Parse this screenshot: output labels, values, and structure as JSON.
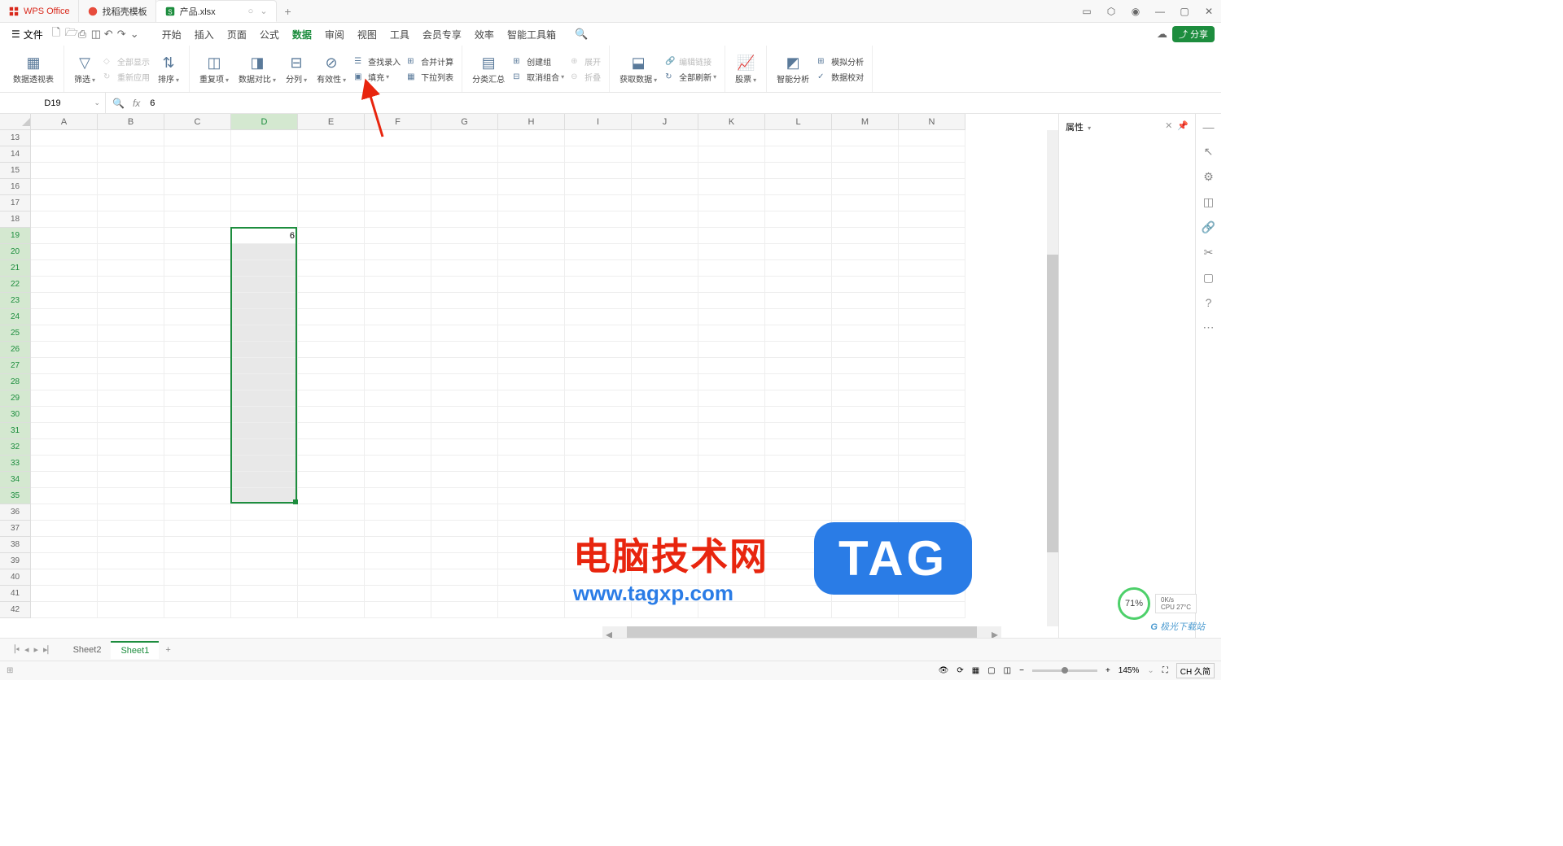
{
  "titlebar": {
    "home_tab": "WPS Office",
    "template_tab": "找稻壳模板",
    "file_tab": "产品.xlsx",
    "add": "+"
  },
  "menubar": {
    "file": "文件",
    "items": [
      "开始",
      "插入",
      "页面",
      "公式",
      "数据",
      "审阅",
      "视图",
      "工具",
      "会员专享",
      "效率",
      "智能工具箱"
    ],
    "active_index": 4,
    "share": "分享"
  },
  "ribbon": {
    "pivot": "数据透视表",
    "filter": "筛选",
    "show_all": "全部显示",
    "reapply": "重新应用",
    "sort": "排序",
    "dup": "重复项",
    "compare": "数据对比",
    "split": "分列",
    "validity": "有效性",
    "find_input": "查找录入",
    "fill": "填充",
    "consolidate": "合并计算",
    "dropdown": "下拉列表",
    "subtotal": "分类汇总",
    "group": "创建组",
    "ungroup": "取消组合",
    "expand": "展开",
    "collapse": "折叠",
    "getdata": "获取数据",
    "editlinks": "编辑链接",
    "refresh": "全部刷新",
    "stock": "股票",
    "smart": "智能分析",
    "sim": "模拟分析",
    "valid2": "数据校对"
  },
  "formulabar": {
    "cell_ref": "D19",
    "fx": "fx",
    "value": "6"
  },
  "side": {
    "properties": "属性"
  },
  "grid": {
    "cols": [
      "A",
      "B",
      "C",
      "D",
      "E",
      "F",
      "G",
      "H",
      "I",
      "J",
      "K",
      "L",
      "M",
      "N"
    ],
    "rows_start": 13,
    "rows_end": 42,
    "active_cell": "D19",
    "active_value": "6",
    "sel_col_index": 3,
    "sel_row_start": 19,
    "sel_row_end": 35
  },
  "sheets": {
    "tabs": [
      "Sheet2",
      "Sheet1"
    ],
    "active_index": 1
  },
  "statusbar": {
    "zoom": "145%",
    "ime": "CH 久简"
  },
  "watermark": {
    "title": "电脑技术网",
    "url": "www.tagxp.com",
    "tag": "TAG",
    "dl_site": "极光下载站"
  },
  "perf": {
    "pct": "71%",
    "net": "0K/s",
    "cpu": "CPU 27°C"
  }
}
